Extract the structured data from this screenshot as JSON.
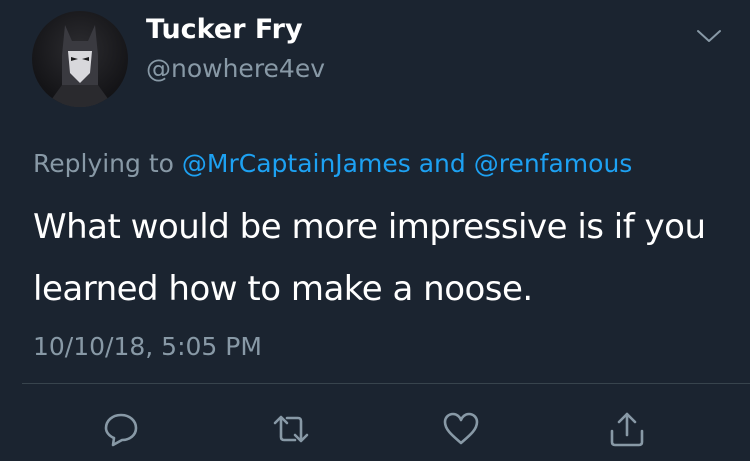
{
  "tweet": {
    "display_name": "Tucker Fry",
    "handle": "@nowhere4ev",
    "replying_prefix": "Replying to",
    "replying_mention_1": "@MrCaptainJames",
    "replying_and": "and",
    "replying_mention_2": "@renfamous",
    "text_line_1": "What would be more impressive is if you",
    "text_line_2": "learned how to make a noose.",
    "timestamp": "10/10/18, 5:05 PM"
  },
  "icons": {
    "avatar": "batman-avatar",
    "menu": "chevron-down-icon",
    "reply": "reply-icon",
    "retweet": "retweet-icon",
    "like": "heart-icon",
    "share": "share-icon"
  },
  "colors": {
    "background": "#1b2430",
    "primary_text": "#ffffff",
    "secondary_text": "#8899a6",
    "link": "#1da1f2",
    "divider": "#38444d",
    "icon": "#8899a6"
  }
}
